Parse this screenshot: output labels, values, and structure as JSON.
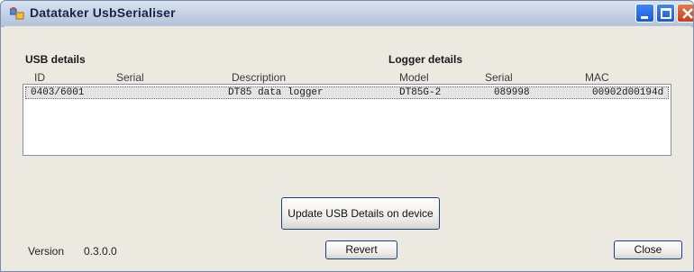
{
  "window": {
    "title": "Datataker UsbSerialiser"
  },
  "usb_section": {
    "label": "USB details"
  },
  "logger_section": {
    "label": "Logger details"
  },
  "columns": [
    "ID",
    "Serial",
    "Description",
    "Model",
    "Serial",
    "MAC"
  ],
  "rows": [
    {
      "id": "0403/6001",
      "serial": "",
      "description": "DT85 data logger",
      "model": "DT85G-2",
      "logger_serial": "089998",
      "mac": "00902d00194d"
    }
  ],
  "buttons": {
    "update": "Update USB Details on device",
    "revert": "Revert",
    "close": "Close"
  },
  "version": {
    "label": "Version",
    "value": "0.3.0.0"
  },
  "colors": {
    "titlebar": "#c3cfe2",
    "window_bg": "#ece9e1",
    "close_button": "#c2411a",
    "selected_row": "#e4e4e6"
  }
}
